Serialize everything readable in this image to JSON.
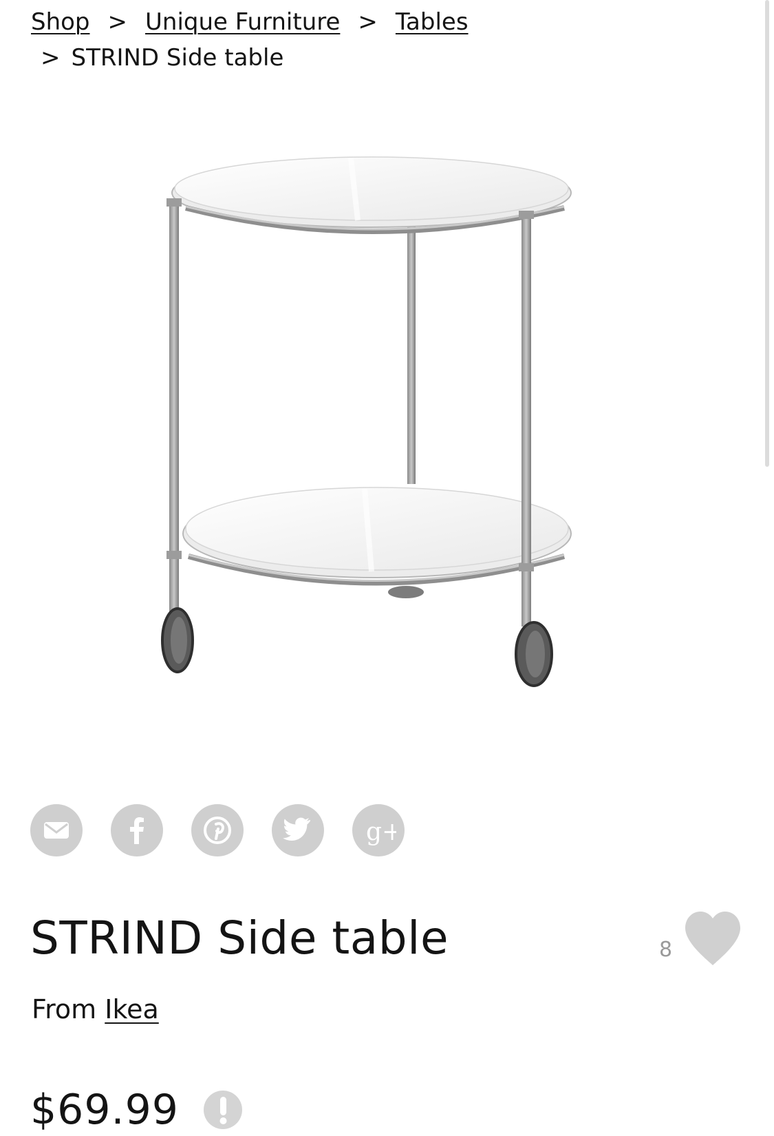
{
  "breadcrumb": {
    "items": [
      {
        "label": "Shop"
      },
      {
        "label": "Unique Furniture"
      },
      {
        "label": "Tables"
      }
    ],
    "separator": ">",
    "current": "STRIND Side table"
  },
  "product": {
    "title": "STRIND Side table",
    "source_prefix": "From",
    "source_name": "Ikea",
    "price": "$69.99",
    "like_count": "8",
    "image_icon": "side-table-image"
  },
  "share": {
    "buttons": [
      {
        "icon": "email-icon"
      },
      {
        "icon": "facebook-icon"
      },
      {
        "icon": "pinterest-icon"
      },
      {
        "icon": "twitter-icon"
      },
      {
        "icon": "google-plus-icon"
      }
    ],
    "google_plus_glyph": "g+"
  },
  "colors": {
    "text": "#141414",
    "icon_bg": "#cfcfcf",
    "heart": "#d0d0d0",
    "muted": "#9a9a9a"
  }
}
